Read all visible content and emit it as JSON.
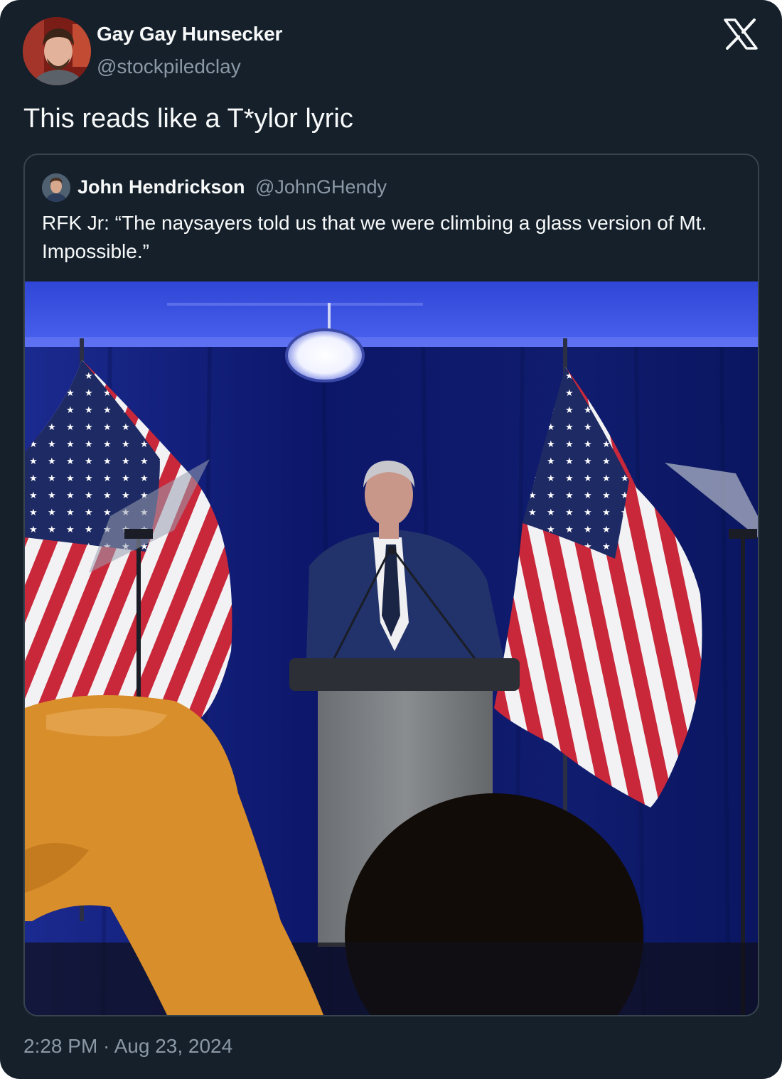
{
  "author": {
    "display_name": "Gay Gay Hunsecker",
    "handle": "@stockpiledclay"
  },
  "tweet": {
    "text": "This reads like a T*ylor lyric",
    "timestamp": "2:28 PM · Aug 23, 2024"
  },
  "quoted_tweet": {
    "display_name": "John Hendrickson",
    "handle": "@JohnGHendy",
    "text": "RFK Jr: “The naysayers told us that we were climbing a glass version of Mt. Impossible.”"
  },
  "icons": {
    "platform_logo": "x-logo-icon"
  },
  "colors": {
    "background": "#15202b",
    "text_primary": "#f7f9f9",
    "text_secondary": "#8b98a5",
    "border": "#38444d"
  }
}
